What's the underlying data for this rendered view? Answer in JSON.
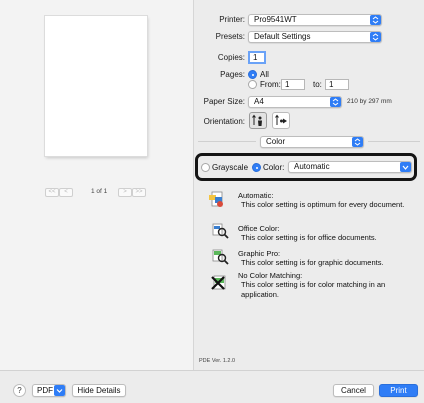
{
  "preview": {
    "pager": {
      "first": "<<",
      "prev": "<",
      "page_text": "1 of 1",
      "next": ">",
      "last": ">>"
    }
  },
  "form": {
    "printer_label": "Printer:",
    "printer_value": "Pro9541WT",
    "presets_label": "Presets:",
    "presets_value": "Default Settings",
    "copies_label": "Copies:",
    "copies_value": "1",
    "pages_label": "Pages:",
    "pages_all": "All",
    "pages_from": "From:",
    "pages_from_value": "1",
    "pages_to": "to:",
    "pages_to_value": "1",
    "paper_size_label": "Paper Size:",
    "paper_size_value": "A4",
    "paper_size_dims": "210 by 297 mm",
    "orientation_label": "Orientation:",
    "section_value": "Color"
  },
  "color_panel": {
    "grayscale_label": "Grayscale",
    "color_label": "Color:",
    "color_value": "Automatic",
    "selected_mode": "color",
    "items": [
      {
        "icon": "automatic-color-icon",
        "title": "Automatic:",
        "desc": [
          "This color setting is optimum for every document."
        ]
      },
      {
        "icon": "office-color-icon",
        "title": "Office Color:",
        "desc": [
          "This color setting is for office documents."
        ]
      },
      {
        "icon": "graphic-pro-icon",
        "title": "Graphic Pro:",
        "desc": [
          "This color setting is for graphic documents."
        ]
      },
      {
        "icon": "no-color-matching-icon",
        "title": "No Color Matching:",
        "desc": [
          "This color setting is for color matching in an",
          "application."
        ]
      }
    ],
    "pde_version": "PDE Ver. 1.2.0"
  },
  "bottom": {
    "help": "?",
    "pdf_label": "PDF",
    "hide_details": "Hide Details",
    "cancel": "Cancel",
    "print": "Print"
  },
  "colors": {
    "accent": "#2f7df6",
    "window_bg": "#ececec",
    "highlight_border": "#151515"
  }
}
